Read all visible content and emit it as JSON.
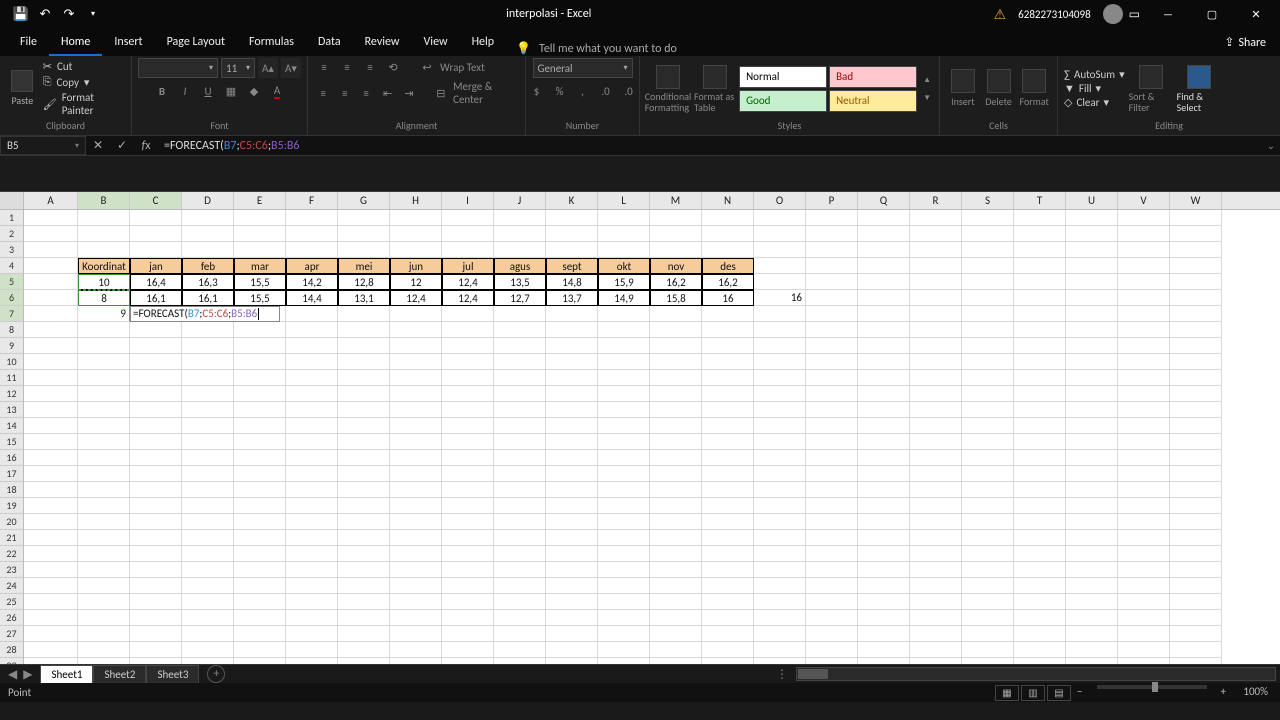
{
  "titlebar": {
    "title": "interpolasi - Excel",
    "account": "6282273104098"
  },
  "tabs": {
    "file": "File",
    "home": "Home",
    "insert": "Insert",
    "pagelayout": "Page Layout",
    "formulas": "Formulas",
    "data": "Data",
    "review": "Review",
    "view": "View",
    "help": "Help",
    "tellme": "Tell me what you want to do",
    "share": "Share"
  },
  "ribbon": {
    "paste": "Paste",
    "cut": "Cut",
    "copy": "Copy",
    "formatpainter": "Format Painter",
    "clipboard": "Clipboard",
    "font": "Font",
    "fontsize": "11",
    "alignment": "Alignment",
    "wraptext": "Wrap Text",
    "mergecenter": "Merge & Center",
    "numberformat": "General",
    "number": "Number",
    "condfmt": "Conditional Formatting",
    "fmttable": "Format as Table",
    "normal": "Normal",
    "bad": "Bad",
    "good": "Good",
    "neutral": "Neutral",
    "styles": "Styles",
    "insert": "Insert",
    "delete": "Delete",
    "format": "Format",
    "cells": "Cells",
    "autosum": "AutoSum",
    "fill": "Fill",
    "clear": "Clear",
    "sortfilter": "Sort & Filter",
    "findselect": "Find & Select",
    "editing": "Editing"
  },
  "fx": {
    "namebox": "B5",
    "fn": "=FORECAST(",
    "a1": "B7",
    "sep": ";",
    "a2": "C5:C6",
    "a3": "B5:B6"
  },
  "columns": [
    "A",
    "B",
    "C",
    "D",
    "E",
    "F",
    "G",
    "H",
    "I",
    "J",
    "K",
    "L",
    "M",
    "N",
    "O",
    "P",
    "Q",
    "R",
    "S",
    "T",
    "U",
    "V",
    "W"
  ],
  "data": {
    "header": [
      "Koordinat",
      "jan",
      "feb",
      "mar",
      "apr",
      "mei",
      "jun",
      "jul",
      "agus",
      "sept",
      "okt",
      "nov",
      "des"
    ],
    "r5": [
      "10",
      "16,4",
      "16,3",
      "15,5",
      "14,2",
      "12,8",
      "12",
      "12,4",
      "13,5",
      "14,8",
      "15,9",
      "16,2",
      "16,2"
    ],
    "r6": [
      "8",
      "16,1",
      "16,1",
      "15,5",
      "14,4",
      "13,1",
      "12,4",
      "12,4",
      "12,7",
      "13,7",
      "14,9",
      "15,8",
      "16",
      "16"
    ],
    "r7b": "9"
  },
  "incell": {
    "pre": "=FORECAST(",
    "a1": "B7",
    "a2": "C5:C6",
    "a3": "B5:B6"
  },
  "sheets": {
    "s1": "Sheet1",
    "s2": "Sheet2",
    "s3": "Sheet3"
  },
  "status": {
    "mode": "Point",
    "zoom": "100%"
  }
}
